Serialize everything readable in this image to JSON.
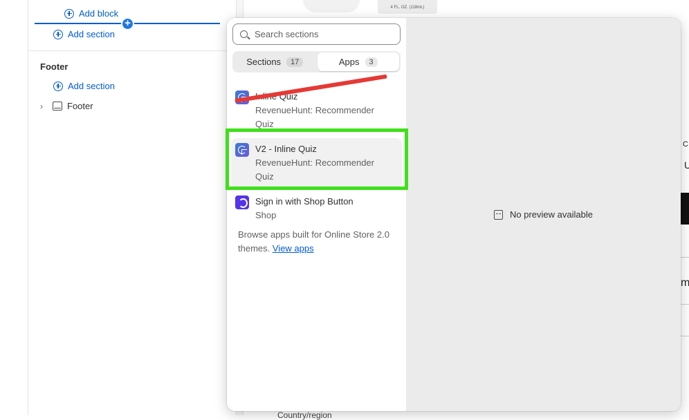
{
  "editor": {
    "add_block_label": "Add block",
    "add_section_label": "Add section",
    "footer_group": {
      "title": "Footer",
      "add_section_label": "Add section",
      "items": [
        {
          "label": "Footer"
        }
      ]
    }
  },
  "background": {
    "bottle_label": "4 FL. OZ. (118mL)",
    "right_text_1": "C",
    "right_text_2": "U",
    "right_text_3": "m",
    "country_label": "Country/region"
  },
  "picker": {
    "search": {
      "placeholder": "Search sections",
      "value": ""
    },
    "tabs": [
      {
        "label": "Sections",
        "count": "17"
      },
      {
        "label": "Apps",
        "count": "3"
      }
    ],
    "active_tab": "Apps",
    "apps": [
      {
        "name": "Inline Quiz",
        "vendor_line1": "RevenueHunt: Recommender",
        "vendor_line2": "Quiz"
      },
      {
        "name": "V2 - Inline Quiz",
        "vendor_line1": "RevenueHunt: Recommender",
        "vendor_line2": "Quiz"
      },
      {
        "name": "Sign in with Shop Button",
        "vendor_line1": "Shop"
      }
    ],
    "browse_text": "Browse apps built for Online Store 2.0 themes.",
    "browse_link": "View apps",
    "preview_text": "No preview available"
  },
  "annotations": {
    "strike_color": "#e53935",
    "highlight_color": "#3fe01a"
  }
}
